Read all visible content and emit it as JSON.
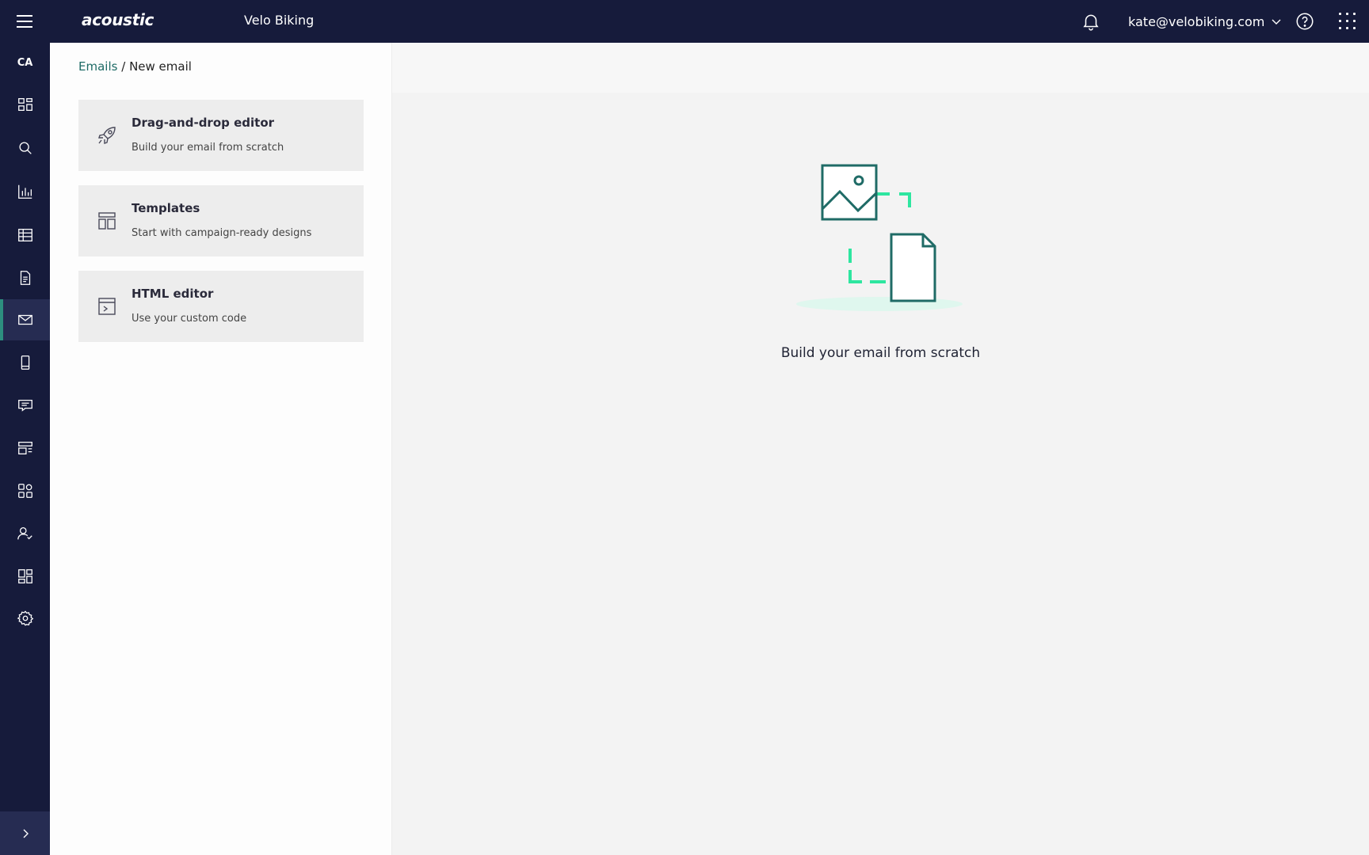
{
  "header": {
    "menu_icon": "hamburger-icon",
    "logo": "acoustic",
    "org_name": "Velo Biking",
    "user_email": "kate@velobiking.com",
    "icons": [
      "bell-icon",
      "chevron-down-icon",
      "help-icon",
      "app-switcher-icon"
    ]
  },
  "sidebar": {
    "badge": "CA",
    "items": [
      {
        "icon": "dashboard-icon",
        "active": false
      },
      {
        "icon": "search-icon",
        "active": false
      },
      {
        "icon": "bar-chart-icon",
        "active": false
      },
      {
        "icon": "table-icon",
        "active": false
      },
      {
        "icon": "document-icon",
        "active": false
      },
      {
        "icon": "email-icon",
        "active": true
      },
      {
        "icon": "mobile-icon",
        "active": false
      },
      {
        "icon": "chat-icon",
        "active": false
      },
      {
        "icon": "forms-icon",
        "active": false
      },
      {
        "icon": "integrations-icon",
        "active": false
      },
      {
        "icon": "user-check-icon",
        "active": false
      },
      {
        "icon": "widgets-icon",
        "active": false
      },
      {
        "icon": "settings-icon",
        "active": false
      }
    ],
    "expand_icon": "chevron-right-icon"
  },
  "breadcrumb": {
    "parent": "Emails",
    "separator": "/",
    "current": "New email"
  },
  "options": [
    {
      "icon": "rocket-icon",
      "title": "Drag-and-drop editor",
      "subtitle": "Build your email from scratch"
    },
    {
      "icon": "template-icon",
      "title": "Templates",
      "subtitle": "Start with campaign-ready designs"
    },
    {
      "icon": "code-window-icon",
      "title": "HTML editor",
      "subtitle": "Use your custom code"
    }
  ],
  "preview": {
    "illustration": "image-to-document-illustration",
    "caption": "Build your email from scratch"
  },
  "colors": {
    "nav_bg": "#161b3b",
    "accent_teal": "#1f6b66",
    "accent_green": "#2ee6a0"
  }
}
